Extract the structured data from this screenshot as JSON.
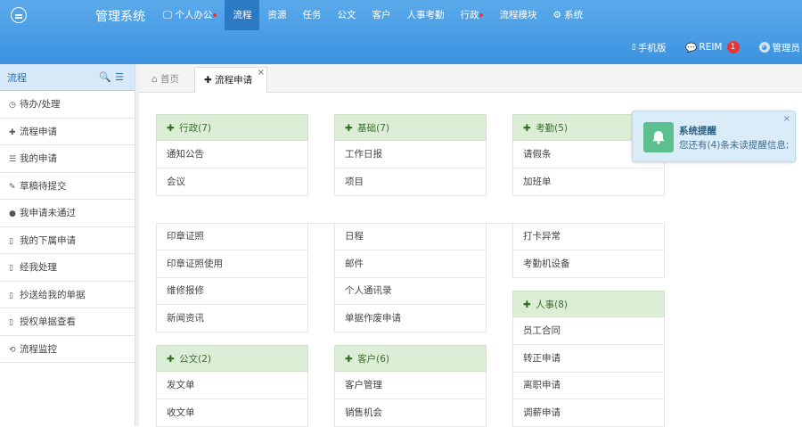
{
  "app_title": "管理系统",
  "nav": [
    {
      "label": "个人办公",
      "icon": "monitor-icon",
      "dot": true
    },
    {
      "label": "流程",
      "active": true
    },
    {
      "label": "资源"
    },
    {
      "label": "任务"
    },
    {
      "label": "公文"
    },
    {
      "label": "客户"
    },
    {
      "label": "人事考勤"
    },
    {
      "label": "行政",
      "dot": true
    },
    {
      "label": "流程模块"
    },
    {
      "label": "系统",
      "icon": "gear-icon"
    }
  ],
  "topright": {
    "mobile": "手机版",
    "reim": "REIM",
    "reim_count": "1",
    "admin": "管理员"
  },
  "sidebar": {
    "title": "流程",
    "items": [
      {
        "label": "待办/处理",
        "icon": "clock-icon"
      },
      {
        "label": "流程申请",
        "icon": "plus-icon"
      },
      {
        "label": "我的申请",
        "icon": "list-icon"
      },
      {
        "label": "草稿待提交",
        "icon": "edit-icon"
      },
      {
        "label": "我申请未通过",
        "icon": "info-icon"
      },
      {
        "label": "我的下属申请",
        "icon": "bookmark-icon"
      },
      {
        "label": "经我处理",
        "icon": "bookmark-icon"
      },
      {
        "label": "抄送给我的单据",
        "icon": "bookmark-icon"
      },
      {
        "label": "授权单据查看",
        "icon": "bookmark-icon"
      },
      {
        "label": "流程监控",
        "icon": "refresh-icon"
      }
    ]
  },
  "tabs": [
    {
      "label": "首页",
      "icon": "home-icon"
    },
    {
      "label": "流程申请",
      "icon": "plus-icon",
      "active": true
    }
  ],
  "groups": {
    "xingzheng": {
      "title": "行政(7)",
      "items": [
        "通知公告",
        "会议",
        "印章证照",
        "印章证照使用",
        "维修报修",
        "新闻资讯"
      ]
    },
    "jichu": {
      "title": "基础(7)",
      "items": [
        "工作日报",
        "项目",
        "日程",
        "邮件",
        "个人通讯录",
        "单据作废申请"
      ]
    },
    "kaoqin": {
      "title": "考勤(5)",
      "items": [
        "请假条",
        "加班单",
        "打卡异常",
        "考勤机设备"
      ]
    },
    "renshi": {
      "title": "人事(8)",
      "items": [
        "员工合同",
        "转正申请",
        "离职申请",
        "调薪申请"
      ]
    },
    "gongwen": {
      "title": "公文(2)",
      "items": [
        "发文单",
        "收文单"
      ]
    },
    "kehu": {
      "title": "客户(6)",
      "items": [
        "客户管理",
        "销售机会"
      ]
    }
  },
  "toast": {
    "title": "系统提醒",
    "message": "您还有(4)条未读提醒信息;"
  },
  "colors": {
    "topbar": "#4a9fe6",
    "nav_active": "#2d7ac4",
    "card_head": "#dcefd6",
    "toast_bg": "#d9ecf7",
    "bell": "#5cbf8e"
  }
}
